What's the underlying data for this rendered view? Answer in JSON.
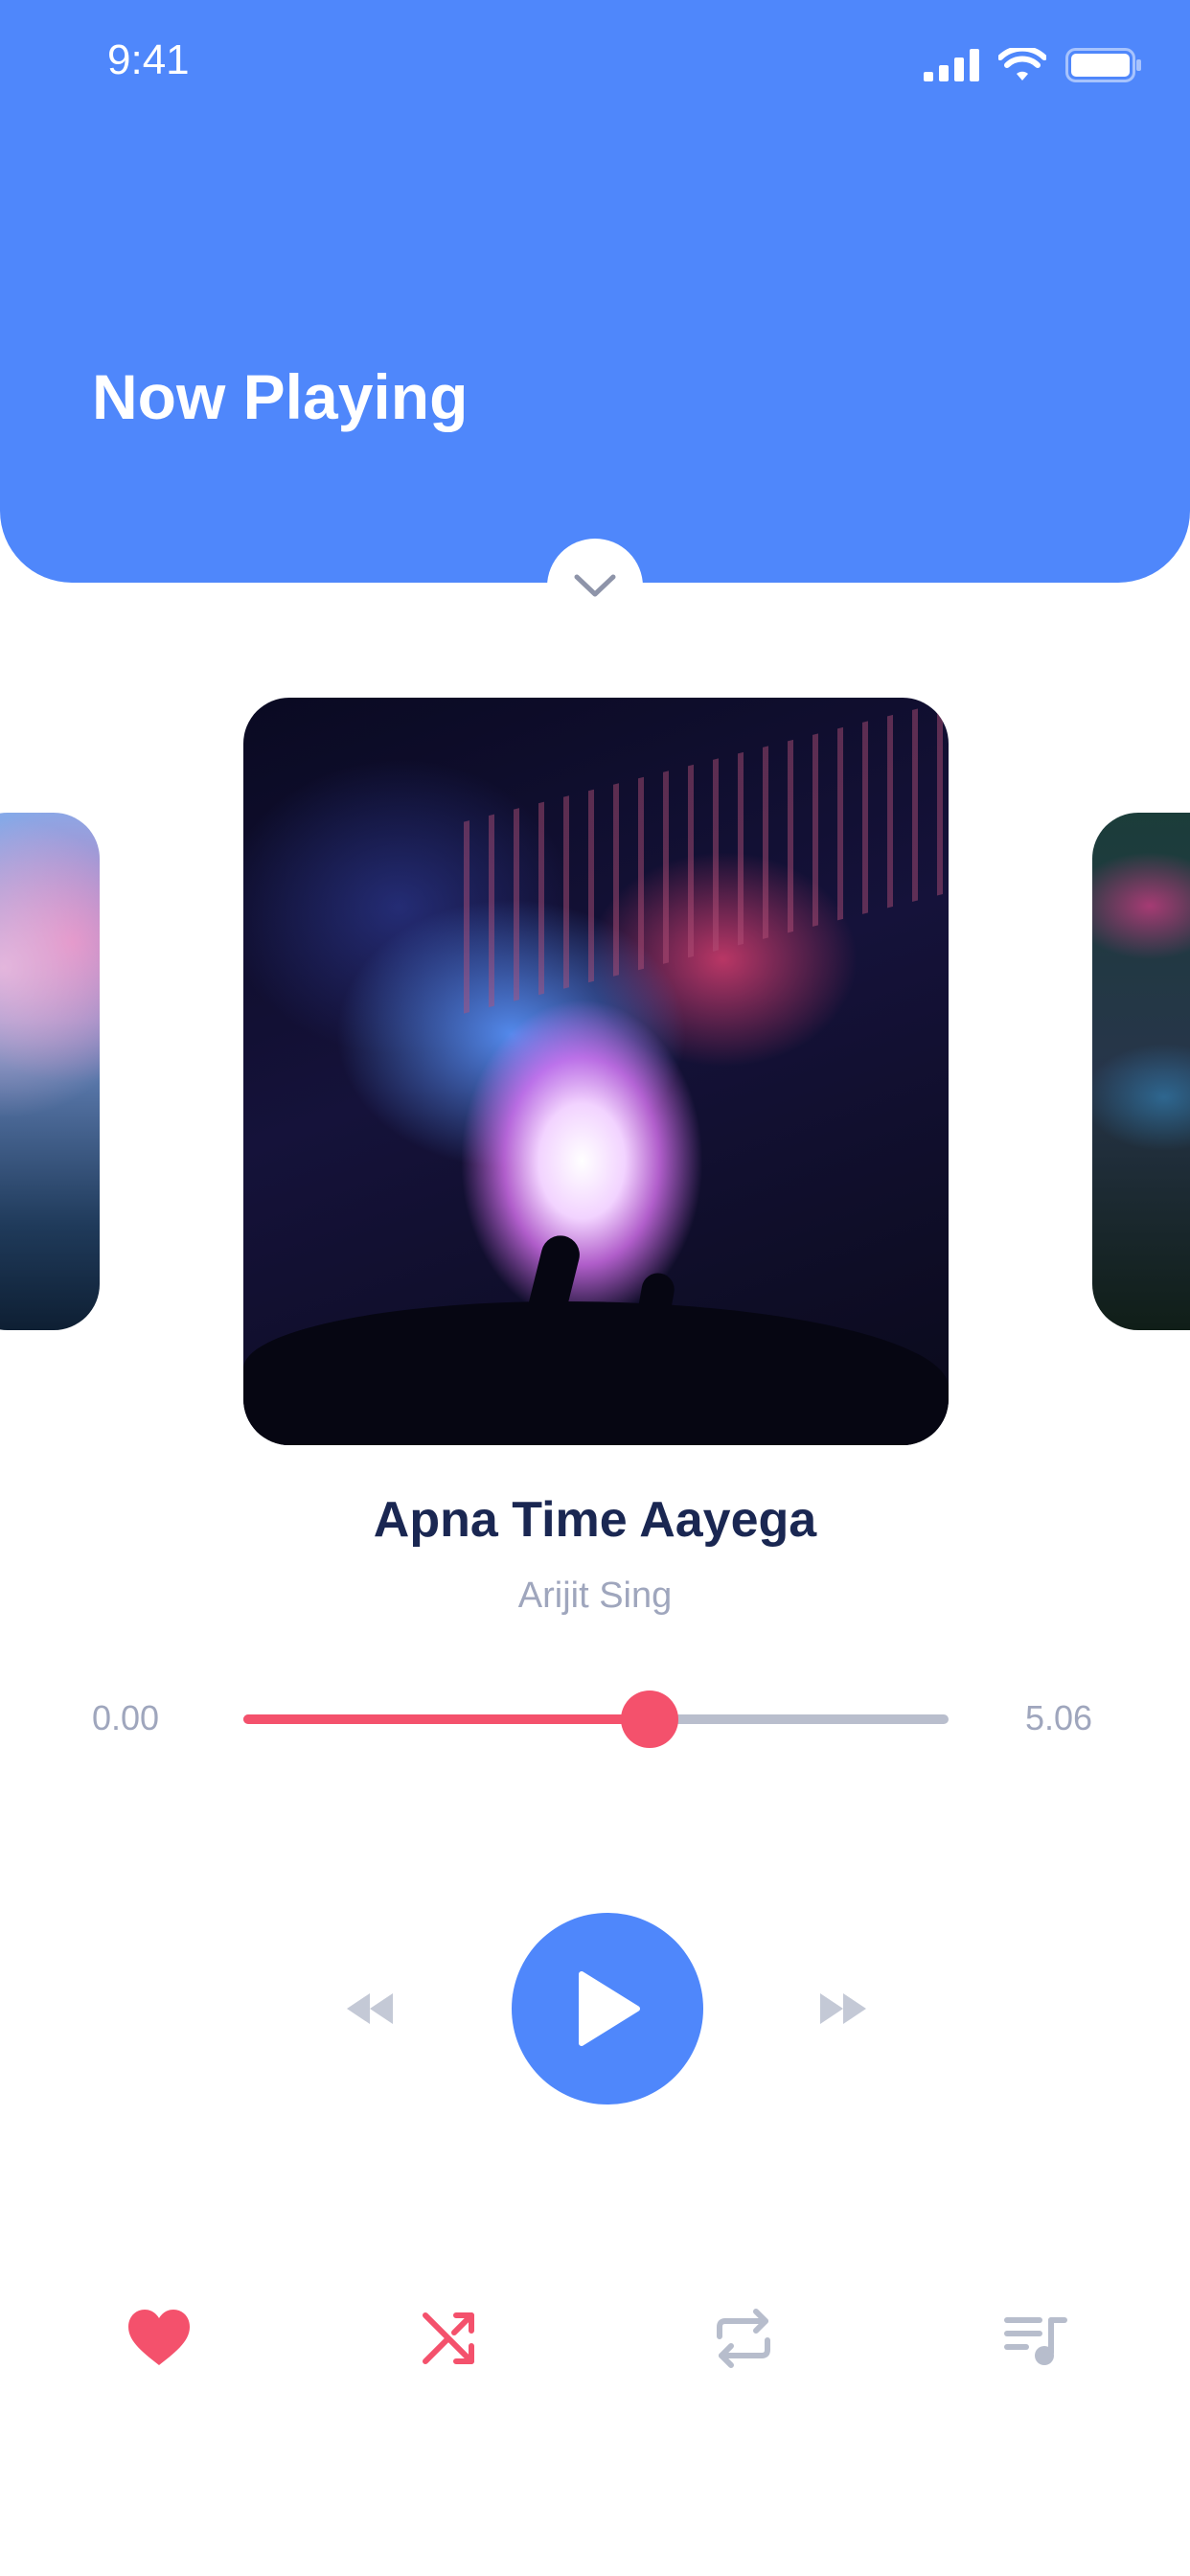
{
  "status_bar": {
    "time": "9:41"
  },
  "header": {
    "title": "Now Playing"
  },
  "track": {
    "title": "Apna Time Aayega",
    "artist": "Arijit Sing",
    "time_current": "0.00",
    "time_total": "5.06",
    "progress": 0.576
  },
  "colors": {
    "accent_blue": "#4F87FB",
    "accent_red": "#F4516C",
    "track_gray": "#B9BECD",
    "icon_gray": "#B7BDCC",
    "title_dark": "#1A2752",
    "text_gray": "#9FA6BD"
  },
  "controls": {
    "rewind_icon": "rewind-icon",
    "play_icon": "play-icon",
    "forward_icon": "fast-forward-icon"
  },
  "bottom_bar": {
    "icons": [
      "heart-icon",
      "shuffle-icon",
      "repeat-icon",
      "queue-music-icon"
    ]
  }
}
